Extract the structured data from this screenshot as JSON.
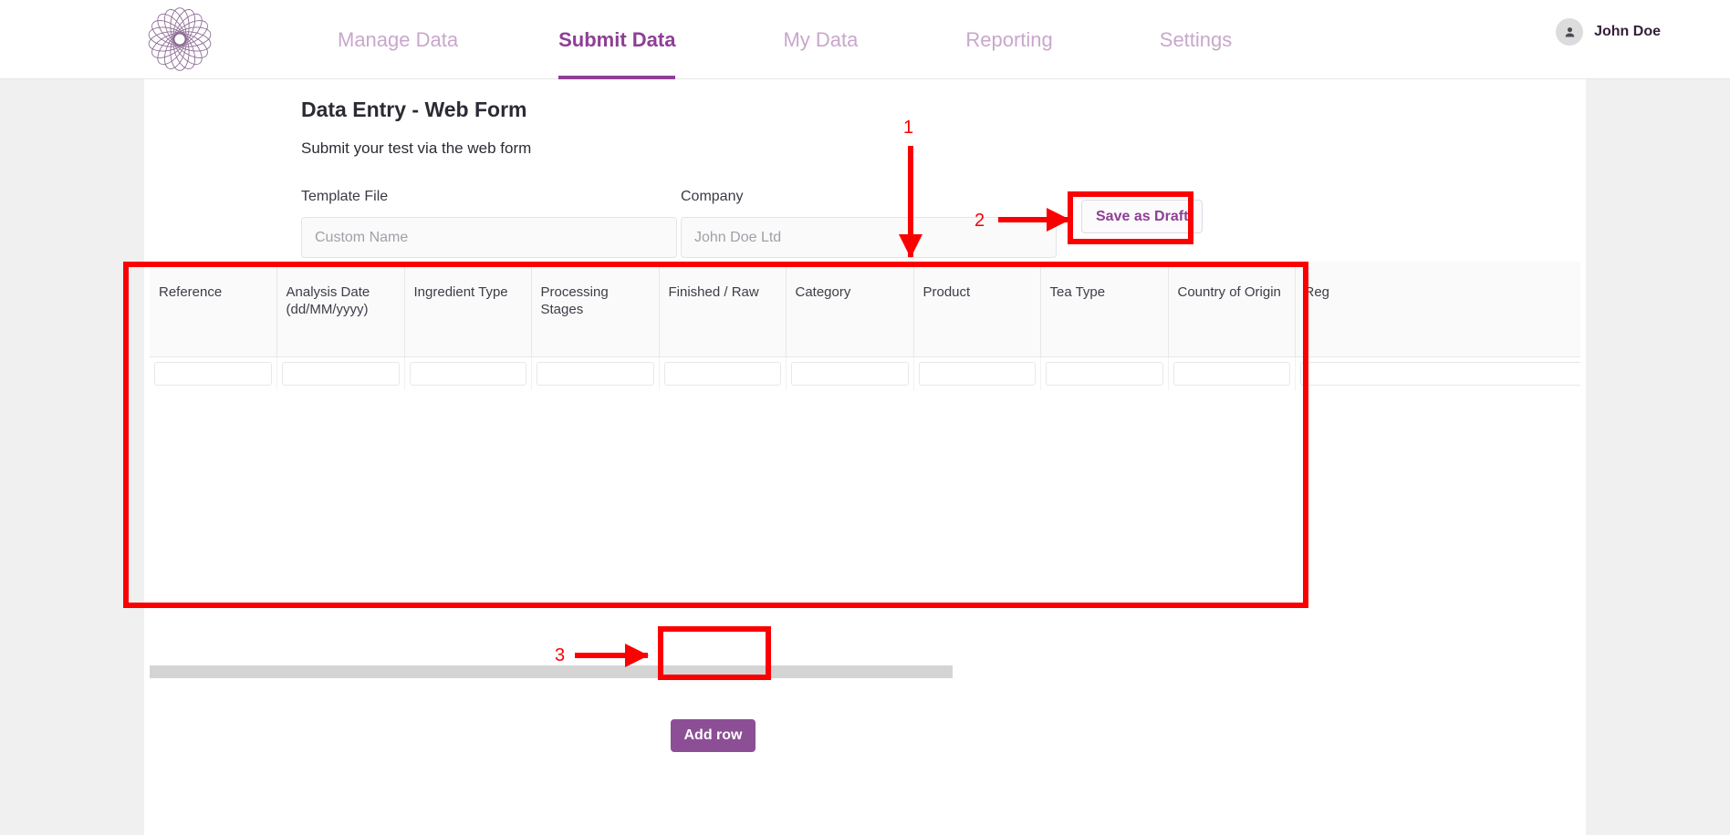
{
  "header": {
    "logo_icon": "flower-mandala-logo",
    "nav": [
      {
        "label": "Manage Data",
        "active": false
      },
      {
        "label": "Submit Data",
        "active": true
      },
      {
        "label": "My Data",
        "active": false
      },
      {
        "label": "Reporting",
        "active": false
      },
      {
        "label": "Settings",
        "active": false
      }
    ],
    "user": {
      "name": "John Doe",
      "avatar_icon": "person-icon"
    }
  },
  "page": {
    "title": "Data Entry - Web Form",
    "subtitle": "Submit your test via the web form"
  },
  "form": {
    "template_file": {
      "label": "Template File",
      "value": "",
      "placeholder": "Custom Name"
    },
    "company": {
      "label": "Company",
      "value": "",
      "placeholder": "John Doe Ltd"
    },
    "save_draft_label": "Save as Draft",
    "add_row_label": "Add row"
  },
  "table": {
    "columns": [
      "Reference",
      "Analysis Date (dd/MM/yyyy)",
      "Ingredient Type",
      "Processing Stages",
      "Finished / Raw",
      "Category",
      "Product",
      "Tea Type",
      "Country of Origin",
      "Reg"
    ],
    "rows": [
      [
        "",
        "",
        "",
        "",
        "",
        "",
        "",
        "",
        "",
        ""
      ]
    ],
    "scroll_position": "left"
  },
  "annotations": [
    {
      "number": "1",
      "target": "data-table",
      "style": "arrow-down"
    },
    {
      "number": "2",
      "target": "save-as-draft-button",
      "style": "arrow-right-with-box"
    },
    {
      "number": "3",
      "target": "add-row-button",
      "style": "arrow-right-with-box"
    }
  ],
  "colors": {
    "brand_purple": "#8e3f96",
    "nav_inactive": "#c9a7cd",
    "button_purple": "#8c4f96",
    "annotation_red": "#fa0000",
    "page_background": "#f0f0f0"
  }
}
